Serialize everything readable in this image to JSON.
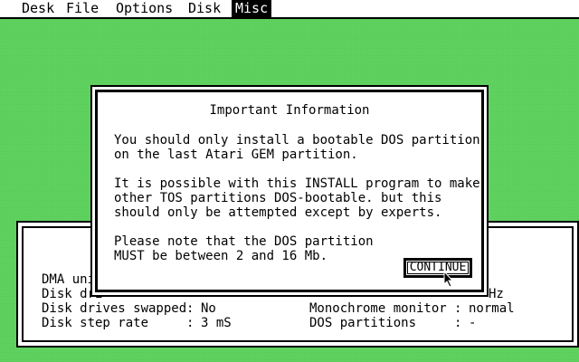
{
  "menubar": {
    "items": [
      "Desk",
      "File",
      "Options",
      "Disk",
      "Misc"
    ],
    "active": "Misc"
  },
  "background_window": {
    "rows": [
      {
        "label": "DMA uni",
        "value": ""
      },
      {
        "label": "Disk dri",
        "value": ""
      },
      {
        "label": "Disk drives swapped",
        "sep": ":",
        "value": "No"
      },
      {
        "label": "Disk step rate",
        "sep": ":",
        "value": "3 mS"
      }
    ],
    "right_rows": [
      {
        "label": "",
        "value": "Hz"
      },
      {
        "label": "Monochrome monitor",
        "sep": ":",
        "value": "normal"
      },
      {
        "label": "DOS partitions",
        "sep": ":",
        "value": "-"
      }
    ]
  },
  "dialog": {
    "title": "Important Information",
    "paragraph1": [
      "You should only install a bootable DOS partition",
      "on the last Atari GEM partition."
    ],
    "paragraph2": [
      "It is possible with this INSTALL program to make",
      "other TOS partitions DOS-bootable. but this",
      "should only be attempted except by experts."
    ],
    "paragraph3": [
      "Please note that the DOS partition",
      "MUST be between 2 and 16 Mb."
    ],
    "button_label": "CONTINUE"
  }
}
